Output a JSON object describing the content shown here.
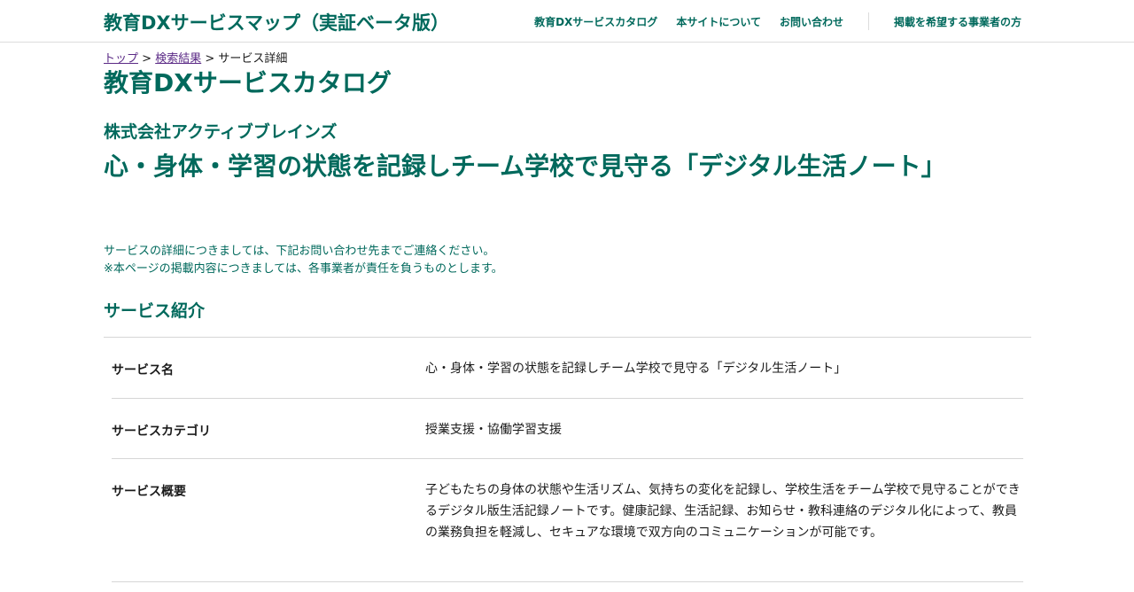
{
  "header": {
    "site_title": "教育DXサービスマップ（実証ベータ版）",
    "nav": [
      {
        "label": "教育DXサービスカタログ"
      },
      {
        "label": "本サイトについて"
      },
      {
        "label": "お問い合わせ"
      },
      {
        "label": "掲載を希望する事業者の方"
      }
    ]
  },
  "breadcrumb": {
    "top": "トップ",
    "search_results": "検索結果",
    "current": "サービス詳細",
    "separator": ">"
  },
  "page_title": "教育DXサービスカタログ",
  "company_name": "株式会社アクティブブレインズ",
  "service_title": "心・身体・学習の状態を記録しチーム学校で見守る「デジタル生活ノート」",
  "notice": {
    "line1": "サービスの詳細につきましては、下記お問い合わせ先までご連絡ください。",
    "line2": "※本ページの掲載内容につきましては、各事業者が責任を負うものとします。"
  },
  "section_title": "サービス紹介",
  "details": [
    {
      "label": "サービス名",
      "value": "心・身体・学習の状態を記録しチーム学校で見守る「デジタル生活ノート」"
    },
    {
      "label": "サービスカテゴリ",
      "value": "授業支援・協働学習支援"
    },
    {
      "label": "サービス概要",
      "value": "子どもたちの身体の状態や生活リズム、気持ちの変化を記録し、学校生活をチーム学校で見守ることができるデジタル版生活記録ノートです。健康記録、生活記録、お知らせ・教科連絡のデジタル化によって、教員の業務負担を軽減し、セキュアな環境で双方向のコミュニケーションが可能です。"
    }
  ]
}
